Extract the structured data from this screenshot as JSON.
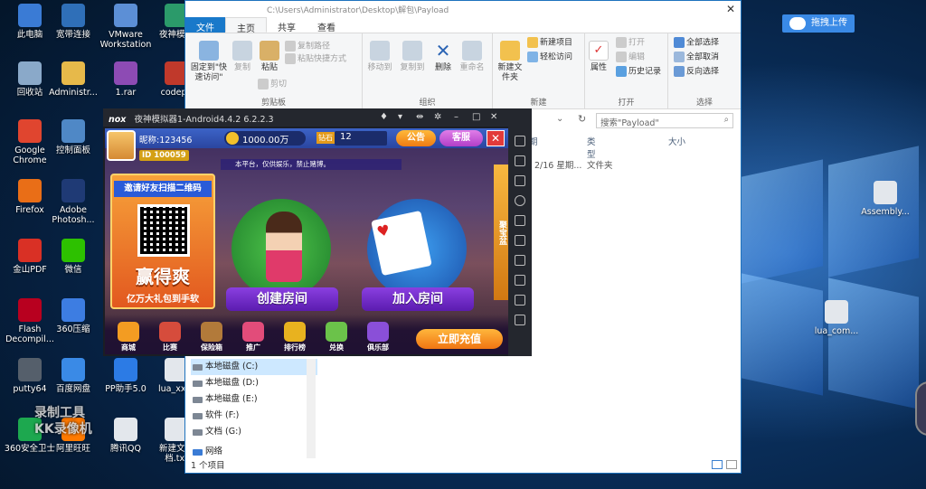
{
  "desktop": {
    "icons": [
      {
        "label": "此电脑",
        "icon": "computer-icon",
        "color": "#3a7bd5"
      },
      {
        "label": "宽带连接",
        "icon": "network-icon",
        "color": "#2f6fb8"
      },
      {
        "label": "VMware Workstation",
        "icon": "vmware-icon",
        "color": "#5c8fd6"
      },
      {
        "label": "夜神模拟",
        "icon": "nox-icon",
        "color": "#2b9a6a"
      },
      {
        "label": "回收站",
        "icon": "recycle-bin-icon",
        "color": "#8aa9c9"
      },
      {
        "label": "Administr...",
        "icon": "user-folder-icon",
        "color": "#e7b94a"
      },
      {
        "label": "1.rar",
        "icon": "rar-icon",
        "color": "#8d4bb4"
      },
      {
        "label": "codepa",
        "icon": "code-icon",
        "color": "#c0392b"
      },
      {
        "label": "Google Chrome",
        "icon": "chrome-icon",
        "color": "#e0452f"
      },
      {
        "label": "控制面板",
        "icon": "control-panel-icon",
        "color": "#4f88c6"
      },
      {
        "label": "Firefox",
        "icon": "firefox-icon",
        "color": "#e96e17"
      },
      {
        "label": "Adobe Photosh...",
        "icon": "photoshop-icon",
        "color": "#1f3a75"
      },
      {
        "label": "金山PDF",
        "icon": "pdf-icon",
        "color": "#d93025"
      },
      {
        "label": "微信",
        "icon": "wechat-icon",
        "color": "#2dc100"
      },
      {
        "label": "Flash Decompil...",
        "icon": "flash-icon",
        "color": "#b8001f"
      },
      {
        "label": "360压缩",
        "icon": "zip-icon",
        "color": "#3d7de2"
      },
      {
        "label": "putty64",
        "icon": "putty-icon",
        "color": "#555f6b"
      },
      {
        "label": "百度网盘",
        "icon": "baidu-pan-icon",
        "color": "#3a8ae6"
      },
      {
        "label": "PP助手5.0",
        "icon": "pp-icon",
        "color": "#2c7be5"
      },
      {
        "label": "lua_xxte",
        "icon": "lua-file-icon",
        "color": "#e3e7ec"
      },
      {
        "label": "360安全卫士",
        "icon": "security-icon",
        "color": "#1da84f"
      },
      {
        "label": "阿里旺旺",
        "icon": "wangwang-icon",
        "color": "#ff7a00"
      },
      {
        "label": "腾讯QQ",
        "icon": "qq-icon",
        "color": "#e3e7ec"
      },
      {
        "label": "新建文本 档.txt",
        "icon": "text-file-icon",
        "color": "#e3e7ec"
      },
      {
        "label": "Assembly...",
        "icon": "assembly-file-icon",
        "color": "#e3e7ec"
      },
      {
        "label": "lua_com...",
        "icon": "lua-file-icon",
        "color": "#e3e7ec"
      }
    ],
    "upload_button": "拖拽上传",
    "watermark": [
      "录制工具",
      "KK录像机"
    ]
  },
  "explorer": {
    "title": "C:\\Users\\Administrator\\Desktop\\解包\\Payload",
    "tabs": [
      "文件",
      "主页",
      "共享",
      "查看"
    ],
    "active_tab": "主页",
    "groups": {
      "clipboard": {
        "label": "剪贴板",
        "pin": "固定到\"快速访问\"",
        "copy": "复制",
        "paste": "粘贴",
        "copy_path": "复制路径",
        "paste_shortcut": "粘贴快捷方式",
        "cut": "剪切"
      },
      "organize": {
        "label": "组织",
        "move_to": "移动到",
        "copy_to": "复制到",
        "delete": "删除",
        "rename": "重命名"
      },
      "new": {
        "label": "新建",
        "new_folder": "新建文件夹",
        "new_item": "新建项目",
        "easy_access": "轻松访问"
      },
      "open": {
        "label": "打开",
        "properties": "属性",
        "open": "打开",
        "edit": "编辑",
        "history": "历史记录"
      },
      "select": {
        "label": "选择",
        "select_all": "全部选择",
        "select_none": "全部取消",
        "invert": "反向选择"
      }
    },
    "search_placeholder": "搜索\"Payload\"",
    "columns": {
      "date": "期",
      "type": "类型",
      "size": "大小"
    },
    "rows": [
      {
        "date": "2/16 星期...",
        "type": "文件夹"
      }
    ],
    "tree": [
      {
        "label": "本地磁盘 (C:)",
        "selected": true
      },
      {
        "label": "本地磁盘 (D:)",
        "selected": false
      },
      {
        "label": "本地磁盘 (E:)",
        "selected": false
      },
      {
        "label": "软件 (F:)",
        "selected": false
      },
      {
        "label": "文档 (G:)",
        "selected": false
      },
      {
        "label": "网络",
        "selected": false
      }
    ],
    "status": "1 个项目"
  },
  "nox": {
    "logo": "nox",
    "title": "夜神模拟器1-Android4.4.2 6.2.2.3",
    "game": {
      "nickname": "昵称:123456",
      "id_label": "ID",
      "id_value": "100059",
      "coins": "1000.00万",
      "gems_label": "钻石",
      "gems": "12",
      "notice": "公告",
      "service": "客服",
      "marquee": "本平台，仅供娱乐，禁止赌博。",
      "promo_head": "邀请好友扫描二维码",
      "promo_win": "赢得爽",
      "promo_gift": "亿万大礼包到手软",
      "create_room": "创建房间",
      "join_room": "加入房间",
      "rightbar": "聚宝盆",
      "nav": [
        {
          "label": "商城",
          "color": "#f39c22"
        },
        {
          "label": "比赛",
          "color": "#d64c3c"
        },
        {
          "label": "保险箱",
          "color": "#b27a3a"
        },
        {
          "label": "推广",
          "color": "#e24c7a"
        },
        {
          "label": "排行榜",
          "color": "#e8b21f"
        },
        {
          "label": "兑换",
          "color": "#6bc24a"
        },
        {
          "label": "俱乐部",
          "color": "#8a4fd8"
        }
      ],
      "recharge": "立即充值"
    }
  }
}
